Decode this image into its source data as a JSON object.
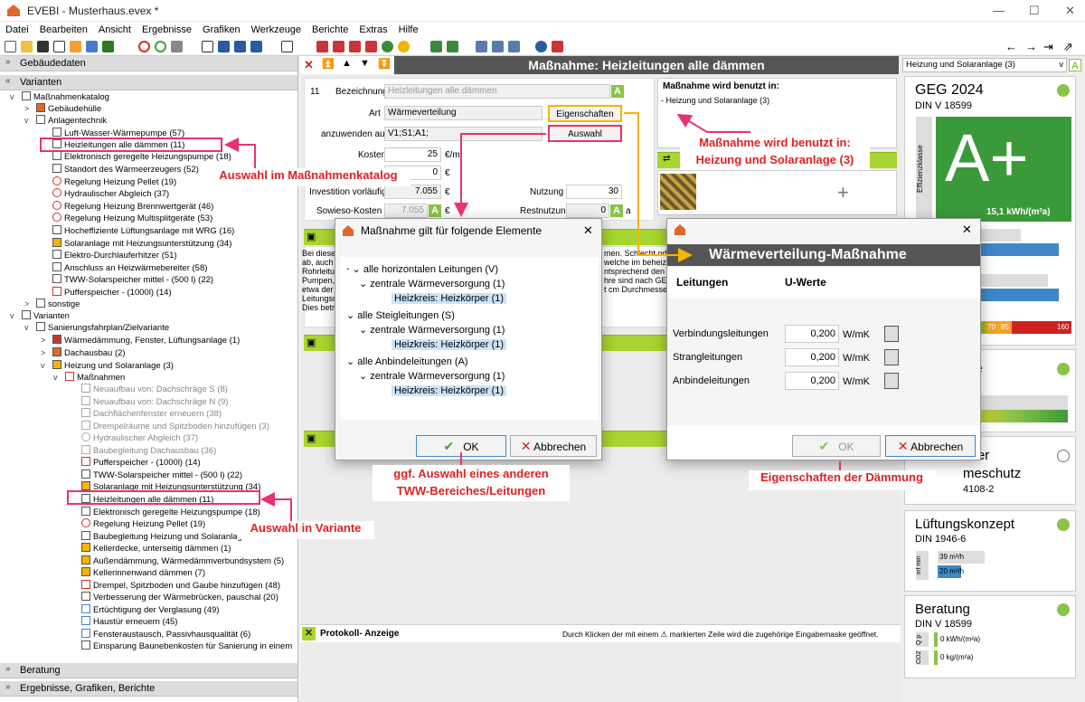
{
  "app": {
    "title": "EVEBI - Musterhaus.evex *"
  },
  "menu": [
    "Datei",
    "Bearbeiten",
    "Ansicht",
    "Ergebnisse",
    "Grafiken",
    "Werkzeuge",
    "Berichte",
    "Extras",
    "Hilfe"
  ],
  "left": {
    "sections": {
      "gebaeude": "Gebäudedaten",
      "varianten": "Varianten",
      "beratung": "Beratung",
      "ergebnisse": "Ergebnisse, Grafiken, Berichte"
    },
    "tree": [
      "Maßnahmenkatalog",
      "Gebäudehülle",
      "Anlagentechnik",
      "Luft-Wasser-Wärmepumpe (57)",
      "Heizleitungen alle dämmen (11)",
      "Elektronisch geregelte Heizungspumpe (18)",
      "Standort des Wärmeerzeugers (52)",
      "Regelung Heizung Pellet (19)",
      "Hydraulischer Abgleich (37)",
      "Regelung Heizung Brennwertgerät (46)",
      "Regelung Heizung Multisplitgeräte (53)",
      "Hocheffiziente Lüftungsanlage mit WRG (16)",
      "Solaranlage mit Heizungsunterstützung (34)",
      "Elektro-Durchlauferhitzer (51)",
      "Anschluss an Heizwärmebereiter (58)",
      "TWW-Solarspeicher mittel - (500 l) (22)",
      "Pufferspeicher - (1000l) (14)",
      "sonstige",
      "Varianten",
      "Sanierungsfahrplan/Zielvariante",
      "Wärmedämmung, Fenster, Lüftungsanlage (1)",
      "Dachausbau (2)",
      "Heizung und Solaranlage (3)",
      "Maßnahmen",
      "Neuaufbau von: Dachschräge S (8)",
      "Neuaufbau von: Dachschräge N (9)",
      "Dachflächenfenster erneuern (38)",
      "Drempelräume und Spitzboden hinzufügen (3)",
      "Hydraulischer Abgleich (37)",
      "Baubegleitung Dachausbau (36)",
      "Pufferspeicher - (1000l) (14)",
      "TWW-Solarspeicher mittel - (500 l) (22)",
      "Solaranlage mit Heizungsunterstützung (34)",
      "Heizleitungen alle dämmen (11)",
      "Elektronisch geregelte Heizungspumpe (18)",
      "Regelung Heizung Pellet (19)",
      "Baubegleitung Heizung und Solaranlage",
      "Kellerdecke, unterseitig dämmen (1)",
      "Außendämmung, Wärmedämmverbundsystem (5)",
      "Kellerinnenwand dämmen (7)",
      "Drempel, Spitzboden und Gaube hinzufügen (48)",
      "Verbesserung der Wärmebrücken, pauschal (20)",
      "Ertüchtigung der Verglasung (49)",
      "Haustür erneuern (45)",
      "Fensteraustausch, Passivhausqualität (6)",
      "Einsparung Baunebenkosten für Sanierung in einem"
    ]
  },
  "center": {
    "title": "Maßnahme: Heizleitungen alle dämmen",
    "nr": "11",
    "bez_label": "Bezeichnung",
    "bez_value": "Heizleitungen alle dämmen",
    "art_label": "Art",
    "art_value": "Wärmeverteilung",
    "eigenschaften": "Eigenschaften",
    "anw_label": "anzuwenden auf",
    "anw_value": "V1;S1;A1;",
    "auswahl": "Auswahl",
    "kosten_label": "Kosten",
    "kosten_value": "25",
    "kosten_unit": "€/m",
    "zero_value": "0",
    "euro": "€",
    "invest_label": "Investition vorläufig",
    "invest_value": "7.055",
    "nutzung_label": "Nutzung",
    "nutzung_value": "30",
    "sowieso_label": "Sowieso-Kosten",
    "sowieso_value": "7.055",
    "rest_label": "Restnutzung",
    "rest_value": "0",
    "a": "a",
    "benutzt_head": "Maßnahme wird benutzt in:",
    "benutzt_item": "- Heizung und Solaranlage (3)",
    "desc": [
      "Bei diese",
      "ab, auch",
      "Rohrleitu",
      "Pumpen,",
      "etwa der",
      "Leitungsd",
      "Dies betr"
    ],
    "desc_right": [
      "men. Schlecht ode",
      "welche im beheizte",
      "ntsprechend den W",
      "hre sind nach GEG",
      "t cm Durchmesser"
    ],
    "protokoll": "Protokoll- Anzeige",
    "protokoll_hint": "Durch Klicken der mit einem ⚠ markierten Zeile wird die zugehörige Eingabemaske geöffnet."
  },
  "dlg1": {
    "title": "Maßnahme gilt für folgende Elemente",
    "items": [
      "alle horizontalen Leitungen (V)",
      "zentrale Wärmeversorgung (1)",
      "Heizkreis: Heizkörper (1)",
      "alle Steigleitungen (S)",
      "zentrale Wärmeversorgung (1)",
      "Heizkreis: Heizkörper (1)",
      "alle Anbindeleitungen (A)",
      "zentrale Wärmeversorgung (1)",
      "Heizkreis: Heizkörper (1)"
    ],
    "ok": "OK",
    "cancel": "Abbrechen"
  },
  "dlg2": {
    "title": "Wärmeverteilung-Maßnahme",
    "col1": "Leitungen",
    "col2": "U-Werte",
    "rows": [
      {
        "l": "Verbindungsleitungen",
        "v": "0,200",
        "u": "W/mK"
      },
      {
        "l": "Strangleitungen",
        "v": "0,200",
        "u": "W/mK"
      },
      {
        "l": "Anbindeleitungen",
        "v": "0,200",
        "u": "W/mK"
      }
    ],
    "ok": "OK",
    "cancel": "Abbrechen"
  },
  "right": {
    "select": "Heizung und Solaranlage (3)",
    "geg": "GEG 2024",
    "geg_din": "DIN V 18599",
    "grade": "A+",
    "value": "15,1 kWh/(m²a)",
    "side": "Effizienzklasse",
    "scale": [
      "70",
      "85",
      "160"
    ],
    "card2_h": "are",
    "card3_h": "cher",
    "card3_h2": "meschutz",
    "card3_s": "4108-2",
    "lueft_h": "Lüftungskonzept",
    "lueft_s": "DIN 1946-6",
    "lueft_b1": "39 m³/h",
    "lueft_b2": "20 m³/h",
    "lueft_side": "inf min",
    "ber_h": "Beratung",
    "ber_s": "DIN V 18599",
    "ber_b1": "0 kWh/(m²a)",
    "ber_b2": "0 kg/(m²a)",
    "ber_l1": "Q p",
    "ber_l2": "CO2"
  },
  "annotations": {
    "a1": "Auswahl im Maßnahmenkatalog",
    "a2": "Auswahl in Variante",
    "a3": "Maßnahme wird benutzt in:\nHeizung und Solaranlage (3)",
    "a4": "ggf. Auswahl eines anderen\nTWW-Bereiches/Leitungen",
    "a5": "Eigenschaften der Dämmung"
  },
  "colors": {
    "green": "#a8d52f",
    "pink": "#e8336b",
    "red": "#e21f1f",
    "orange": "#f5b400",
    "blue": "#3f87c9"
  }
}
